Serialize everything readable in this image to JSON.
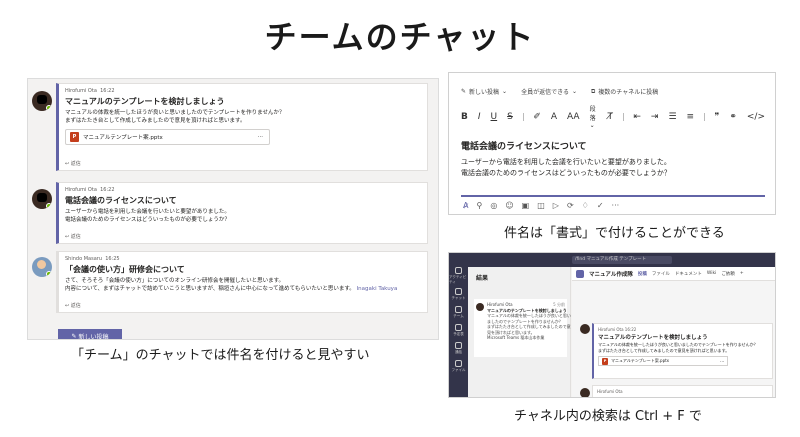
{
  "title": "チームのチャット",
  "captions": {
    "left": "「チーム」のチャットでは件名を付けると見やすい",
    "top_right": "件名は「書式」で付けることができる",
    "bottom_right": "チャネル内の検索は Ctrl + F で"
  },
  "posts": [
    {
      "author": "Hirofumi Ota",
      "time": "16:22",
      "subject": "マニュアルのテンプレートを検討しましょう",
      "body": [
        "マニュアルの体裁を統一したほうが良いと思いましたのでテンプレートを作りませんか？",
        "まずはたたき台として作成してみましたので意見を頂ければと思います。"
      ],
      "attachment": "マニュアルテンプレート案.pptx",
      "reply": "返信"
    },
    {
      "author": "Hirofumi Ota",
      "time": "16:22",
      "subject": "電話会議のライセンスについて",
      "body": [
        "ユーザーから電話を利用した会議を行いたいと要望がありました。",
        "電話会議のためのライセンスはどういったものが必要でしょうか？"
      ],
      "reply": "返信"
    },
    {
      "author": "Shindo Masaru",
      "time": "16:25",
      "subject": "「会議の使い方」研修会について",
      "body": [
        "さて、そろそろ「会議の使い方」についてのオンライン研修会を開催したいと思います。",
        "内容について、まずはチャットで詰めていこうと思いますが、稲垣さんに中心になって進めてもらいたいと思います。"
      ],
      "mention": "Inagaki Takuya",
      "reply": "返信"
    }
  ],
  "new_post_button": "新しい投稿",
  "compose": {
    "new_post": "新しい投稿",
    "reply_all": "全員が返信できる",
    "post_to_multiple": "複数のチャネルに投稿",
    "format_bar": [
      "B",
      "I",
      "U",
      "S",
      "段落"
    ],
    "subject": "電話会議のライセンスについて",
    "body": [
      "ユーザーから電話を利用した会議を行いたいと要望がありました。",
      "電話会議のためのライセンスはどういったものが必要でしょうか？"
    ]
  },
  "teams": {
    "search": "/find マニュアル作成 テンプレート",
    "rail": [
      "アクティビティ",
      "チャット",
      "チーム",
      "予定表",
      "通話",
      "ファイル"
    ],
    "list_header": "結果",
    "result": {
      "author": "Hirofumi Ota",
      "time": "5 分前",
      "subject": "マニュアルのテンプレートを検討しましょう",
      "body": [
        "マニュアルの体裁を統一したほうが良いと思い",
        "ましたのでテンプレートを作りませんか？",
        "まずはたたき台として作成してみましたので意",
        "見を頂ければと思います。"
      ],
      "source": "Microsoft Teams 稲本山本作業"
    },
    "channel_name": "マニュアル作成隊",
    "tabs": [
      "投稿",
      "ファイル",
      "ドキュメント",
      "Wiki",
      "ご依頼"
    ],
    "post": {
      "author": "Hirofumi Ota",
      "time": "16:22",
      "subject": "マニュアルのテンプレートを検討しましょう",
      "body": [
        "マニュアルの体裁を統一したほうが良いと思いましたのでテンプレートを作りませんか？",
        "まずはたたき台として作成してみましたので意見を頂ければと思います。"
      ],
      "attachment": "マニュアルテンプレート案.pptx"
    },
    "post2_author": "Hirofumi Ota"
  }
}
